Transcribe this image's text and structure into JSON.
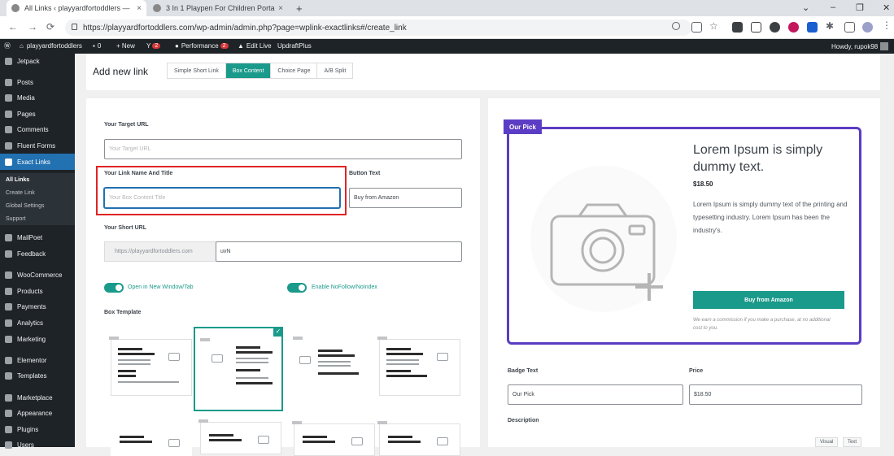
{
  "browser": {
    "tabs": [
      {
        "title": "All Links ‹ playyardfortoddlers —",
        "close": "×"
      },
      {
        "title": "3 In 1 Playpen For Children Porta",
        "close": "×"
      }
    ],
    "new_tab": "+",
    "url": "https://playyardfortoddlers.com/wp-admin/admin.php?page=wplink-exactlinks#/create_link",
    "window_controls": [
      "⌄",
      "–",
      "❐",
      "✕"
    ],
    "nav": {
      "back": "←",
      "forward": "→",
      "reload": "⟳"
    }
  },
  "adminbar": {
    "site": "playyardfortoddlers",
    "comments_count": "0",
    "new": "+ New",
    "yoast_count": "2",
    "performance": "Performance",
    "performance_count": "2",
    "edit_live": "Edit Live",
    "updraft": "UpdraftPlus",
    "howdy": "Howdy, rupok98"
  },
  "sidebar": {
    "items": [
      {
        "label": "Jetpack"
      },
      {
        "label": "Posts"
      },
      {
        "label": "Media"
      },
      {
        "label": "Pages"
      },
      {
        "label": "Comments"
      },
      {
        "label": "Fluent Forms"
      },
      {
        "label": "Exact Links"
      },
      {
        "label": "MailPoet"
      },
      {
        "label": "Feedback"
      },
      {
        "label": "WooCommerce"
      },
      {
        "label": "Products"
      },
      {
        "label": "Payments"
      },
      {
        "label": "Analytics"
      },
      {
        "label": "Marketing"
      },
      {
        "label": "Elementor"
      },
      {
        "label": "Templates"
      },
      {
        "label": "Marketplace"
      },
      {
        "label": "Appearance"
      },
      {
        "label": "Plugins"
      },
      {
        "label": "Users"
      }
    ],
    "submenu": [
      "All Links",
      "Create Link",
      "Global Settings",
      "Support"
    ]
  },
  "header": {
    "title": "Add new link",
    "tabs": [
      "Simple Short Link",
      "Box Content",
      "Choice Page",
      "A/B Split"
    ]
  },
  "form": {
    "target_url_label": "Your Target URL",
    "target_url_placeholder": "Your Target URL",
    "link_name_label": "Your Link Name And Title",
    "link_name_placeholder": "Your Box Content Title",
    "button_text_label": "Button Text",
    "button_text_value": "Buy from Amazon",
    "short_url_label": "Your Short URL",
    "short_url_prefix": "https://playyardfortoddlers.com",
    "short_url_slug": "uvN",
    "toggle_new_window": "Open in New Window/Tab",
    "toggle_nofollow": "Enable NoFollow/NoIndex",
    "box_template_label": "Box Template",
    "selected_mark": "✓"
  },
  "preview": {
    "badge": "Our Pick",
    "title": "Lorem Ipsum is simply dummy text.",
    "price": "$18.50",
    "description": "Lorem Ipsum is simply dummy text of the printing and typesetting industry. Lorem Ipsum has been the industry's.",
    "button": "Buy from Amazon",
    "note": "We earn a commission if you make a purchase, at no additional cost to you.",
    "badge_text_label": "Badge Text",
    "badge_text_value": "Our Pick",
    "price_label": "Price",
    "price_value": "$18.50",
    "description_label": "Description",
    "editor_tabs": [
      "Visual",
      "Text"
    ]
  },
  "colors": {
    "accent": "#1a9a8a",
    "purple": "#5b3cc4",
    "highlight": "#e02424",
    "wp_blue": "#2271b1"
  }
}
